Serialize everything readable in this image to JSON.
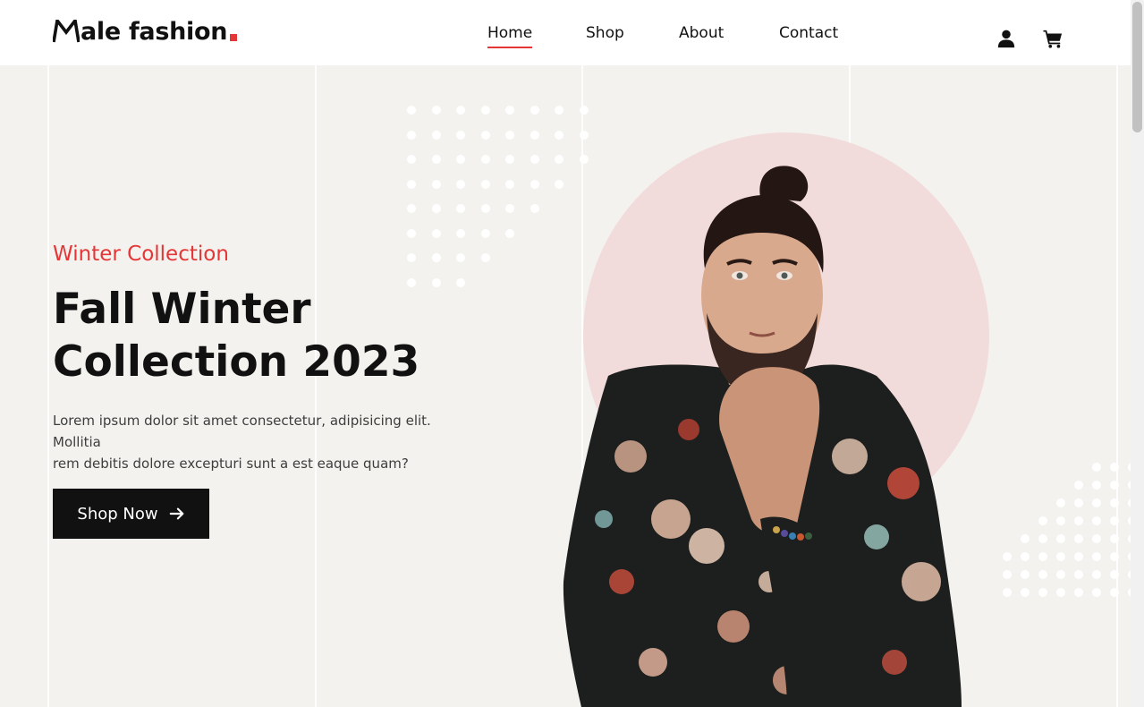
{
  "header": {
    "logo_text": "Male fashion",
    "nav": [
      {
        "label": "Home",
        "active": true
      },
      {
        "label": "Shop",
        "active": false
      },
      {
        "label": "About",
        "active": false
      },
      {
        "label": "Contact",
        "active": false
      }
    ],
    "icons": [
      "user-icon",
      "cart-icon"
    ]
  },
  "hero": {
    "subtitle": "Winter Collection",
    "title_line1": "Fall Winter",
    "title_line2": "Collection 2023",
    "description_line1": "Lorem ipsum dolor sit amet consectetur, adipisicing elit. Mollitia",
    "description_line2": "rem debitis dolore excepturi sunt a est eaque quam?",
    "cta_label": "Shop Now",
    "cta_icon": "arrow-right-icon"
  },
  "colors": {
    "accent": "#e53637",
    "background": "#f3f2ee",
    "dark": "#111111",
    "circle": "#f2dcdb"
  }
}
